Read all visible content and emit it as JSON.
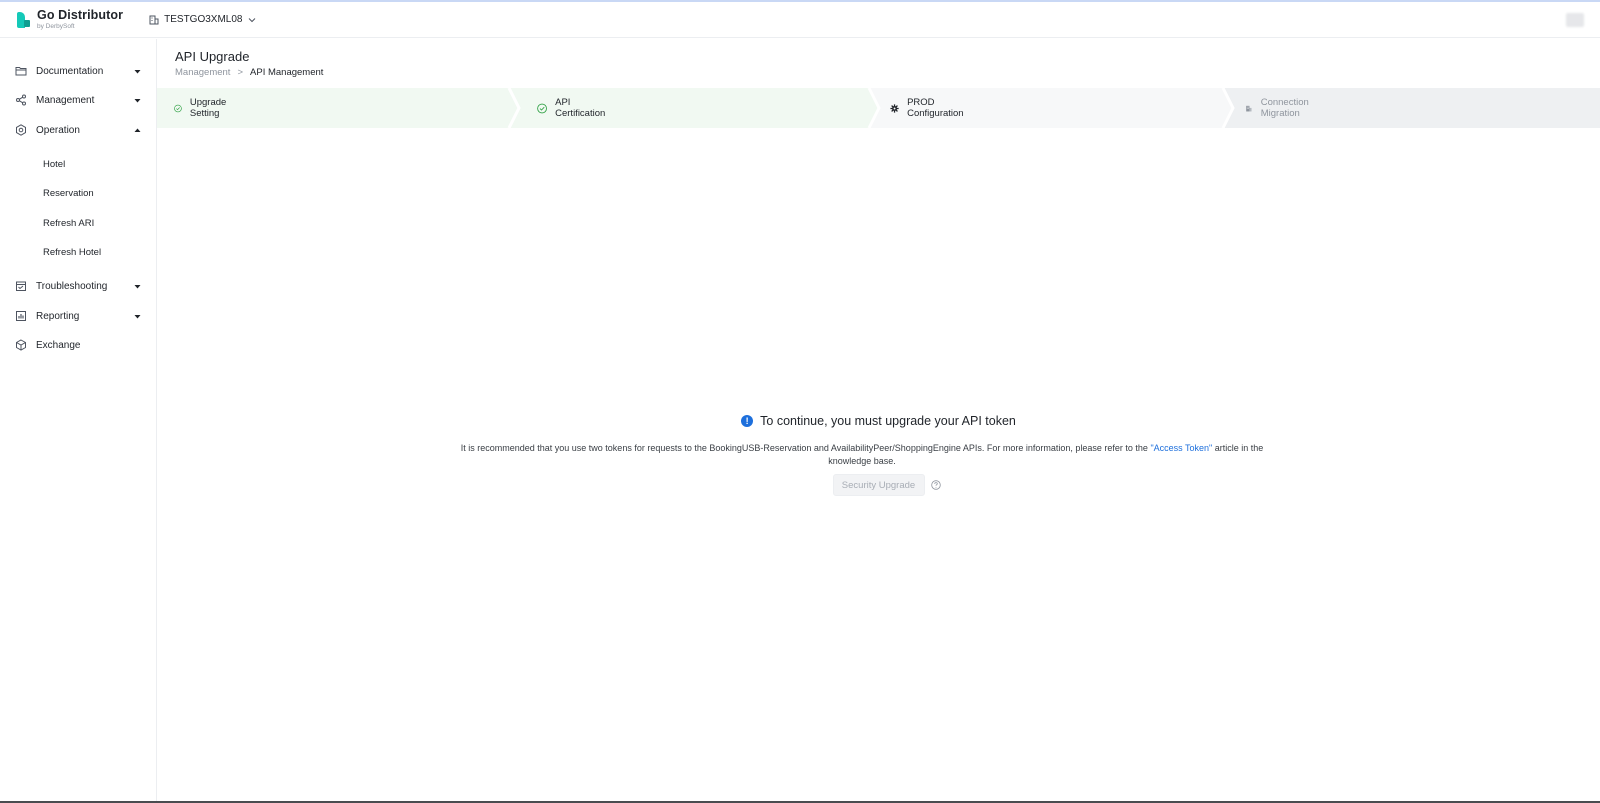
{
  "app": {
    "logo_title": "Go Distributor",
    "logo_subtitle": "by DerbySoft",
    "tenant": "TESTGO3XML08"
  },
  "sidebar": {
    "items": [
      {
        "label": "Documentation",
        "expanded": false
      },
      {
        "label": "Management",
        "expanded": false
      },
      {
        "label": "Operation",
        "expanded": true
      },
      {
        "label": "Troubleshooting",
        "expanded": false
      },
      {
        "label": "Reporting",
        "expanded": false
      },
      {
        "label": "Exchange"
      }
    ],
    "operation_children": [
      "Hotel",
      "Reservation",
      "Refresh ARI",
      "Refresh Hotel"
    ]
  },
  "page": {
    "title": "API Upgrade",
    "breadcrumb_parent": "Management",
    "breadcrumb_separator": ">",
    "breadcrumb_current": "API Management"
  },
  "steps": [
    {
      "label": "Upgrade Setting",
      "status": "done"
    },
    {
      "label": "API Certification",
      "status": "done"
    },
    {
      "label": "PROD Configuration",
      "status": "current"
    },
    {
      "label": "Connection Migration",
      "status": "pending"
    }
  ],
  "notice": {
    "title": "To continue, you must upgrade your API token",
    "body_before": "It is recommended that you use two tokens for requests to the BookingUSB-Reservation and AvailabilityPeer/ShoppingEngine APIs. For more information, please refer to the ",
    "link_text": "\"Access Token\"",
    "body_after": " article in the knowledge base.",
    "button_label": "Security Upgrade"
  },
  "colors": {
    "brand": "#14c9b8",
    "step_done_bg": "#f1f9f2",
    "step_done_icon": "#2ea043",
    "step_pending_bg": "#eef0f2",
    "link": "#1d6fdc"
  }
}
